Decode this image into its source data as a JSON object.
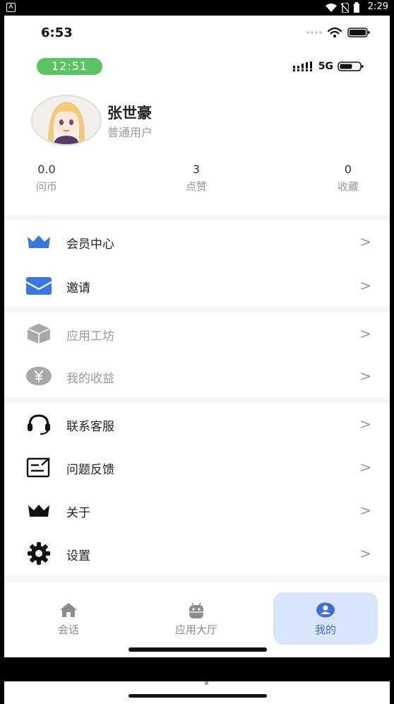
{
  "system_bar": {
    "time": "2:29",
    "badge": "A"
  },
  "inner_status": {
    "time": "6:53"
  },
  "second_status": {
    "time_pill": "12:51",
    "network": "5G"
  },
  "profile": {
    "name": "张世豪",
    "role": "普通用户",
    "avatar_icon": "anime-avatar-icon"
  },
  "stats": [
    {
      "value": "0.0",
      "label": "问币"
    },
    {
      "value": "3",
      "label": "点赞"
    },
    {
      "value": "0",
      "label": "收藏"
    }
  ],
  "menu": {
    "vip": {
      "label": "会员中心",
      "icon": "crown-icon"
    },
    "invite": {
      "label": "邀请",
      "icon": "envelope-icon"
    },
    "workshop": {
      "label": "应用工坊",
      "icon": "box-icon"
    },
    "earnings": {
      "label": "我的收益",
      "icon": "yen-icon"
    },
    "support": {
      "label": "联系客服",
      "icon": "headset-icon"
    },
    "feedback": {
      "label": "问题反馈",
      "icon": "feedback-icon"
    },
    "about": {
      "label": "关于",
      "icon": "crown-icon"
    },
    "settings": {
      "label": "设置",
      "icon": "gear-icon"
    },
    "chevron": ">"
  },
  "tabs": [
    {
      "label": "会话",
      "icon": "home-icon"
    },
    {
      "label": "应用大厅",
      "icon": "android-icon"
    },
    {
      "label": "我的",
      "icon": "user-icon"
    }
  ],
  "colors": {
    "accent": "#3f6fd8",
    "active_tab_bg": "#d7e6fb",
    "icon_blue": "#3a78e0",
    "pill_green": "#5ac463"
  }
}
